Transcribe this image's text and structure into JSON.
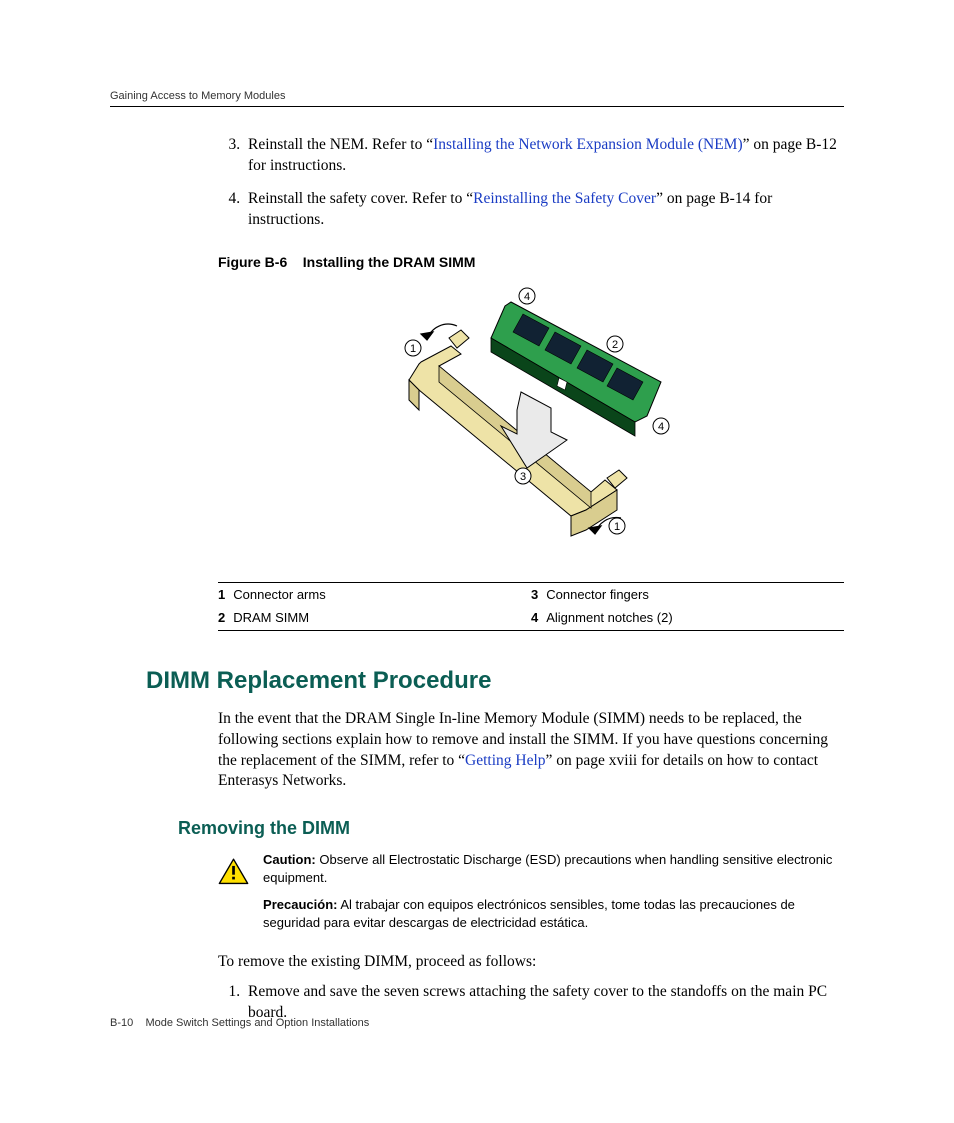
{
  "header": {
    "running_head": "Gaining Access to Memory Modules"
  },
  "steps_top": [
    {
      "num": "3.",
      "pre": "Reinstall the NEM. Refer to “",
      "link": "Installing the Network Expansion Module (NEM)",
      "post": "” on page B-12 for instructions."
    },
    {
      "num": "4.",
      "pre": "Reinstall the safety cover. Refer to “",
      "link": "Reinstalling the Safety Cover",
      "post": "” on page B-14 for instructions."
    }
  ],
  "figure": {
    "caption_num": "Figure B-6",
    "caption_title": "Installing the DRAM SIMM",
    "callouts": {
      "r1c1n": "1",
      "r1c1t": "Connector arms",
      "r1c2n": "3",
      "r1c2t": "Connector fingers",
      "r2c1n": "2",
      "r2c1t": "DRAM SIMM",
      "r2c2n": "4",
      "r2c2t": "Alignment notches (2)"
    }
  },
  "section": {
    "title": "DIMM Replacement Procedure",
    "intro_pre": "In the event that the DRAM Single In-line Memory Module (SIMM) needs to be replaced, the following sections explain how to remove and install the SIMM. If you have questions concerning the replacement of the SIMM, refer to “",
    "intro_link": "Getting Help",
    "intro_post": "”  on page xviii for details on how to contact Enterasys Networks."
  },
  "subsection": {
    "title": "Removing the DIMM",
    "caution_label": "Caution:",
    "caution_text": " Observe all Electrostatic Discharge (ESD) precautions when handling sensitive electronic equipment.",
    "precaucion_label": "Precaución:",
    "precaucion_text": " Al trabajar con equipos electrónicos sensibles, tome todas las precauciones de seguridad para evitar descargas  de electricidad estática.",
    "lead_in": "To remove the existing DIMM, proceed as follows:",
    "steps": [
      {
        "num": "1.",
        "text": "Remove and save the seven screws attaching the safety cover to the standoffs on the main PC board."
      }
    ]
  },
  "footer": {
    "page": "B-10",
    "label": "Mode Switch Settings and Option Installations"
  },
  "markers": {
    "m1": "1",
    "m2": "2",
    "m3": "3",
    "m4": "4"
  }
}
